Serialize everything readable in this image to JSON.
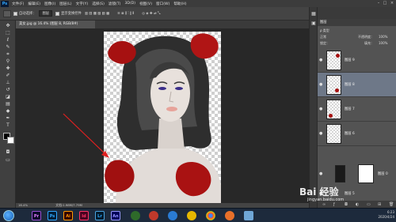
{
  "app": {
    "name": "Ps"
  },
  "menu": [
    "文件(F)",
    "编辑(E)",
    "图像(I)",
    "图层(L)",
    "文字(Y)",
    "选择(S)",
    "滤镜(T)",
    "3D(D)",
    "视图(V)",
    "窗口(W)",
    "帮助(H)"
  ],
  "options_bar": {
    "auto_select_label": "自动选择：",
    "auto_select_value": "图层",
    "show_transform_label": "显示变换控件"
  },
  "document": {
    "tab_title": "美女.jpg @ 16.4% (图层 8, RGB/8#)"
  },
  "status": {
    "zoom": "16.4%",
    "doc_info": "文档:1.98M/7.79M"
  },
  "layers_panel": {
    "tabs": [
      "图层"
    ],
    "filter_label": "ρ 类型",
    "blend_mode": "正常",
    "opacity_label": "不透明度：",
    "opacity_value": "100%",
    "lock_label": "锁定：",
    "fill_label": "填充：",
    "fill_value": "100%",
    "layers": [
      {
        "name": "图层 9",
        "selected": false
      },
      {
        "name": "图层 8",
        "selected": true
      },
      {
        "name": "图层 7",
        "selected": false
      },
      {
        "name": "图层 6",
        "selected": false
      },
      {
        "name": "图层 5",
        "selected": false
      }
    ],
    "mask_layer_name": "图层 0"
  },
  "colors": {
    "petal": "#a61111",
    "selected_layer": "#6e7888",
    "arrow": "#e02020"
  },
  "taskbar": {
    "apps": [
      "Pr",
      "Ps",
      "Ai",
      "Id",
      "Lr",
      "An"
    ],
    "clock_time": "6:23",
    "clock_date": "2020/4/24"
  },
  "watermark": {
    "line1": "Bai 经验",
    "line2": "jingyan.baidu.com"
  }
}
